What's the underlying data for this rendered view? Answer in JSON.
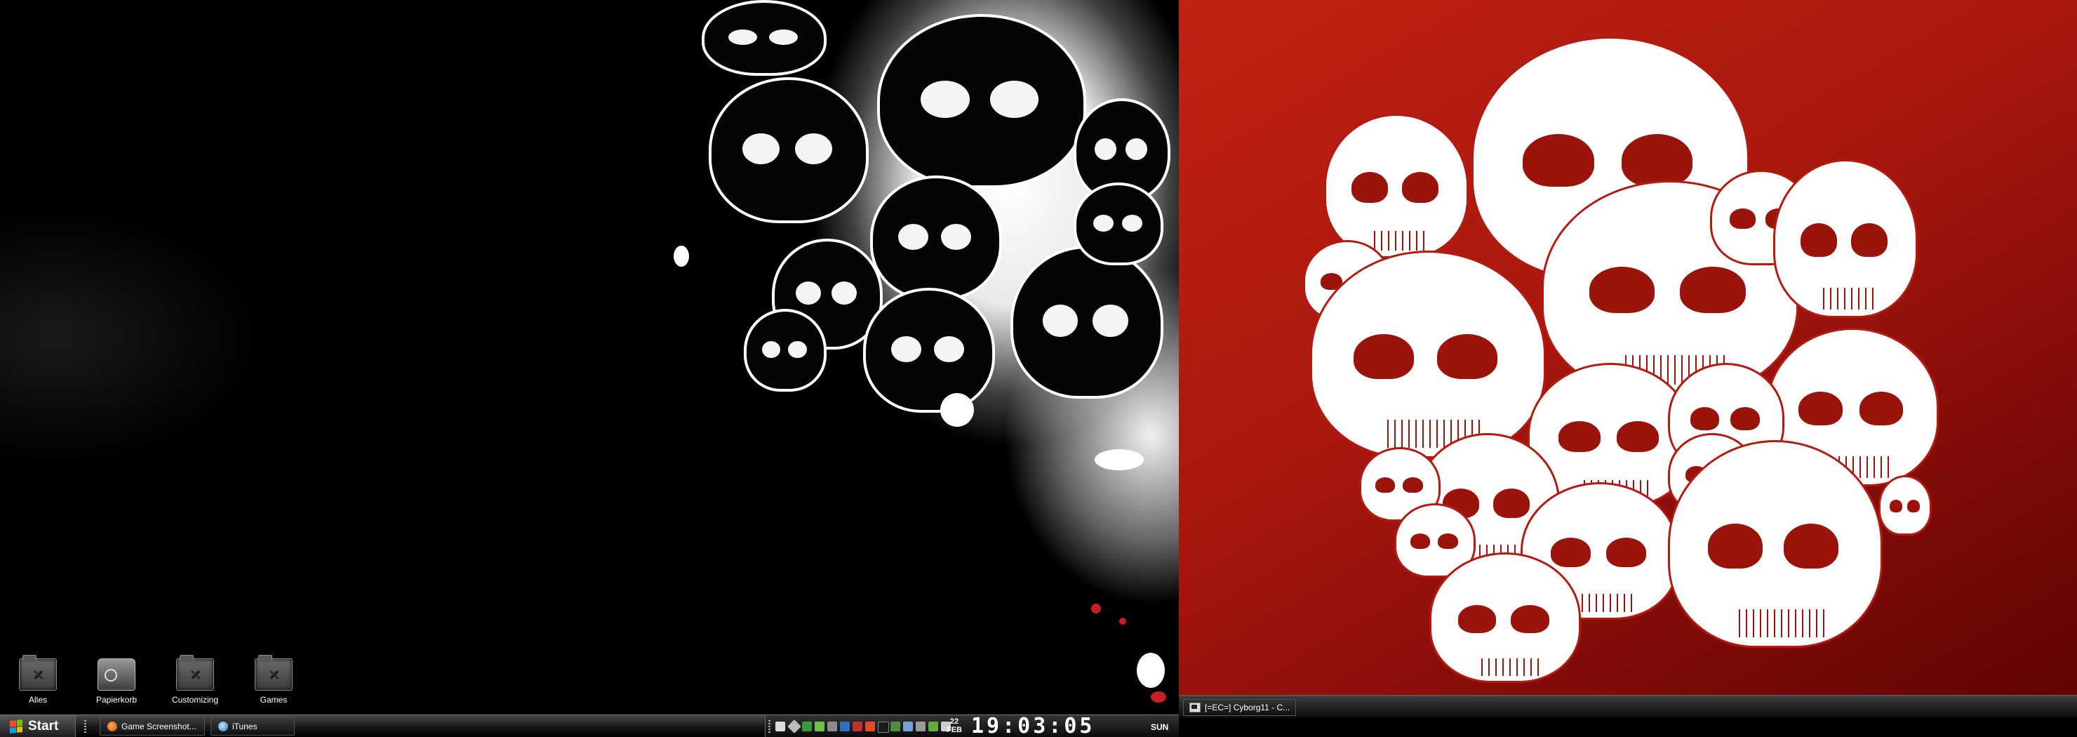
{
  "desktop_left": {
    "icons": [
      {
        "label": "Alles",
        "icon": "folder-icon"
      },
      {
        "label": "Papierkorb",
        "icon": "recycle-bin-icon"
      },
      {
        "label": "Customizing",
        "icon": "folder-icon"
      },
      {
        "label": "Games",
        "icon": "folder-icon"
      }
    ]
  },
  "taskbar_left": {
    "start_label": "Start",
    "tasks": [
      {
        "label": "Game Screenshot...",
        "icon": "firefox-icon"
      },
      {
        "label": "iTunes",
        "icon": "itunes-icon"
      }
    ],
    "clock": {
      "day_num": "22",
      "month": "FEB",
      "time": "19:03:05",
      "weekday": "SUN"
    }
  },
  "taskbar_right": {
    "tasks": [
      {
        "label": "[=EC=] Cyborg11 - C...",
        "icon": "console-icon"
      }
    ]
  },
  "colors": {
    "wallpaper_right": "#b01c10",
    "taskbar": "#1a1a1a"
  }
}
